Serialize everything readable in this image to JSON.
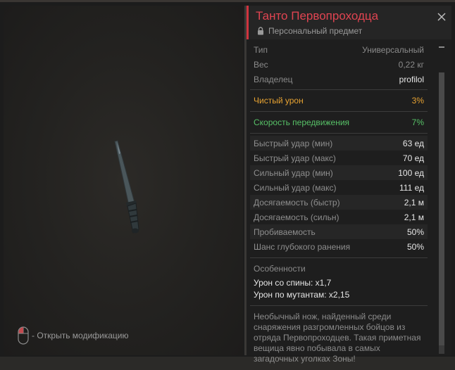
{
  "item": {
    "title": "Танто Первопроходца",
    "subtitle": "Персональный предмет"
  },
  "info": [
    {
      "k": "Тип",
      "v": "Универсальный"
    },
    {
      "k": "Вес",
      "v": "0,22 кг"
    },
    {
      "k": "Владелец",
      "v": "profilol"
    }
  ],
  "highlights": {
    "damage": {
      "k": "Чистый урон",
      "v": "3%"
    },
    "speed": {
      "k": "Скорость передвижения",
      "v": "7%"
    }
  },
  "stats": [
    {
      "k": "Быстрый удар (мин)",
      "v": "63 ед"
    },
    {
      "k": "Быстрый удар (макс)",
      "v": "70 ед"
    },
    {
      "k": "Сильный удар (мин)",
      "v": "100 ед"
    },
    {
      "k": "Сильный удар (макс)",
      "v": "111 ед"
    },
    {
      "k": "Досягаемость (быстр)",
      "v": "2,1 м"
    },
    {
      "k": "Досягаемость (сильн)",
      "v": "2,1 м"
    },
    {
      "k": "Пробиваемость",
      "v": "50%"
    },
    {
      "k": "Шанс глубокого ранения",
      "v": "50%"
    }
  ],
  "features": {
    "title": "Особенности",
    "lines": [
      "Урон со спины: x1,7",
      "Урон по мутантам: x2,15"
    ]
  },
  "description": "Необычный нож, найденный среди снаряжения разгромленных бойцов из отряда Первопроходцев. Такая приметная вещица явно побывала в самых загадочных уголках Зоны!",
  "hint": {
    "label": "- Открыть модификацию",
    "icon": "mouse-icon"
  },
  "colors": {
    "accent": "#d0343e",
    "title": "#e04451",
    "damage": "#e7a332",
    "speed": "#57c167"
  }
}
